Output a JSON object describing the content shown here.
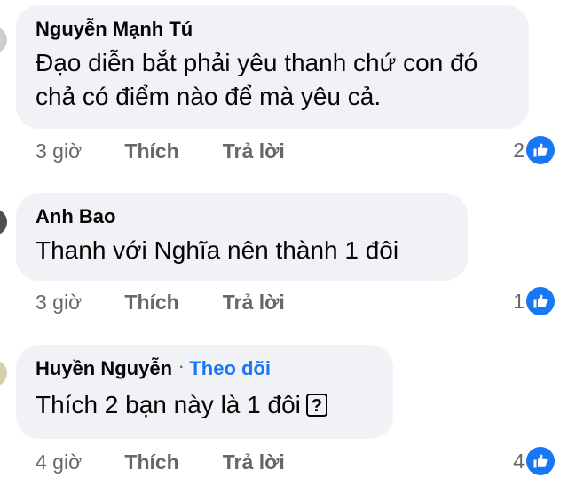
{
  "comments": [
    {
      "author": "Nguyễn Mạnh Tú",
      "text": "Đạo diễn bắt phải yêu thanh chứ con đó chả có điểm nào để mà yêu cả.",
      "time": "3 giờ",
      "like_label": "Thích",
      "reply_label": "Trả lời",
      "reaction_count": "2",
      "reaction_icon": "like-icon"
    },
    {
      "author": "Anh Bao",
      "text": "Thanh với Nghĩa nên thành 1 đôi",
      "time": "3 giờ",
      "like_label": "Thích",
      "reply_label": "Trả lời",
      "reaction_count": "1",
      "reaction_icon": "like-icon"
    },
    {
      "author": "Huyền Nguyễn",
      "separator": "·",
      "follow_label": "Theo dõi",
      "text": "Thích 2 bạn này là 1 đôi",
      "emoji_glyph": "?",
      "time": "4 giờ",
      "like_label": "Thích",
      "reply_label": "Trả lời",
      "reaction_count": "4",
      "reaction_icon": "like-icon"
    }
  ],
  "colors": {
    "bubble_bg": "#f0f2f5",
    "secondary_text": "#65676b",
    "accent_blue": "#1877f2",
    "text": "#050505"
  }
}
